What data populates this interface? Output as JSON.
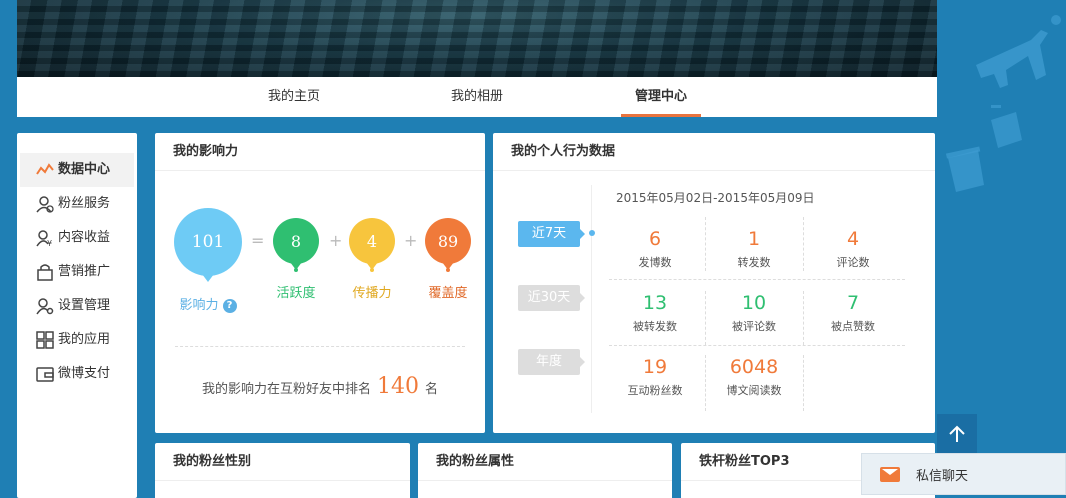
{
  "nav": {
    "tabs": [
      {
        "label": "我的主页"
      },
      {
        "label": "我的相册"
      },
      {
        "label": "管理中心"
      }
    ]
  },
  "sidebar": {
    "items": [
      {
        "label": "数据中心",
        "icon": "trend-icon"
      },
      {
        "label": "粉丝服务",
        "icon": "fans-service-icon"
      },
      {
        "label": "内容收益",
        "icon": "income-icon"
      },
      {
        "label": "营销推广",
        "icon": "bag-icon"
      },
      {
        "label": "设置管理",
        "icon": "settings-user-icon"
      },
      {
        "label": "我的应用",
        "icon": "apps-grid-icon"
      },
      {
        "label": "微博支付",
        "icon": "wallet-icon"
      }
    ]
  },
  "influence": {
    "title": "我的影响力",
    "total": {
      "value": "101",
      "label": "影响力",
      "help": "?"
    },
    "activity": {
      "value": "8",
      "label": "活跃度"
    },
    "spread": {
      "value": "4",
      "label": "传播力"
    },
    "coverage": {
      "value": "89",
      "label": "覆盖度"
    },
    "ops": {
      "eq": "=",
      "plus": "+"
    },
    "rank": {
      "prefix": "我的影响力在互粉好友中排名",
      "value": "140",
      "suffix": "名"
    },
    "colors": {
      "total": "#6ecbf5",
      "activity": "#2fbf71",
      "spread": "#f7c53d",
      "coverage": "#f07a3a"
    }
  },
  "behavior": {
    "title": "我的个人行为数据",
    "periods": [
      "近7天",
      "近30天",
      "年度"
    ],
    "date_range": "2015年05月02日-2015年05月09日",
    "stats": [
      {
        "value": "6",
        "label": "发博数"
      },
      {
        "value": "1",
        "label": "转发数"
      },
      {
        "value": "4",
        "label": "评论数"
      },
      {
        "value": "13",
        "label": "被转发数"
      },
      {
        "value": "10",
        "label": "被评论数"
      },
      {
        "value": "7",
        "label": "被点赞数"
      },
      {
        "value": "19",
        "label": "互动粉丝数"
      },
      {
        "value": "6048",
        "label": "博文阅读数"
      }
    ]
  },
  "bottom": {
    "gender_title": "我的粉丝性别",
    "attr_title": "我的粉丝属性",
    "top3_title": "铁杆粉丝TOP3"
  },
  "chat": {
    "label": "私信聊天"
  }
}
